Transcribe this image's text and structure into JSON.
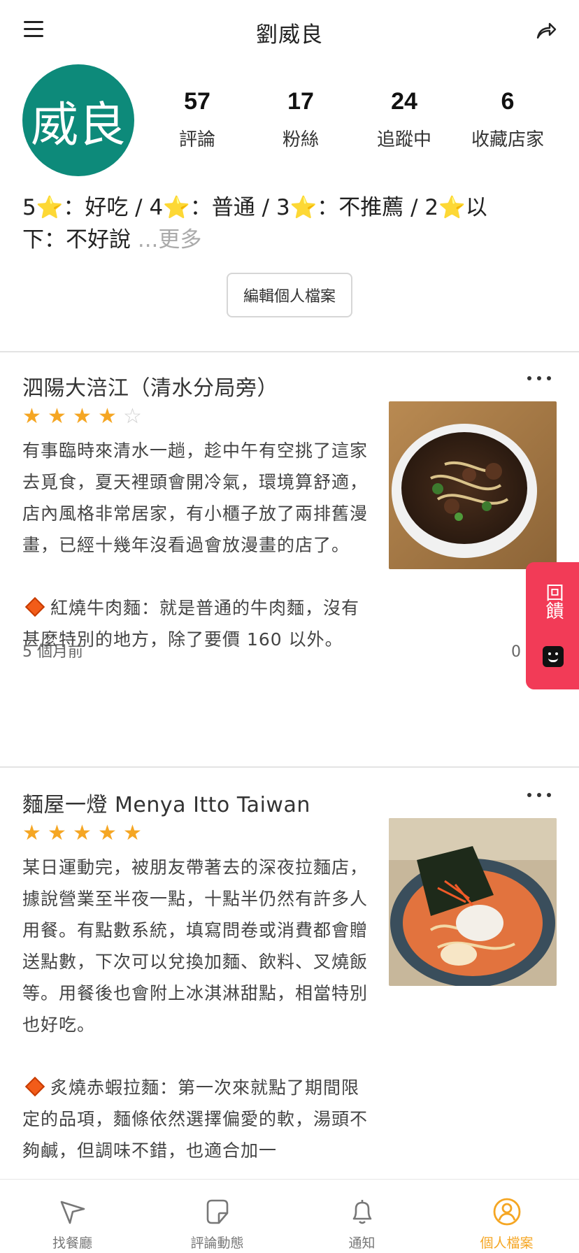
{
  "header": {
    "title": "劉威良"
  },
  "profile": {
    "avatar_text": "威良",
    "stats": [
      {
        "num": "57",
        "label": "評論"
      },
      {
        "num": "17",
        "label": "粉絲"
      },
      {
        "num": "24",
        "label": "追蹤中"
      },
      {
        "num": "6",
        "label": "收藏店家"
      }
    ],
    "bio_line1": "5⭐：好吃 / 4⭐：普通 / 3⭐：不推薦 / 2⭐以",
    "bio_line2": "下：不好說",
    "bio_more": " ...更多",
    "edit_label": "編輯個人檔案"
  },
  "reviews": [
    {
      "name": "泗陽大涪江（清水分局旁）",
      "rating": 4,
      "body": "有事臨時來清水一趟，趁中午有空挑了這家去覓食，夏天裡頭會開冷氣，環境算舒適，店內風格非常居家，有小櫃子放了兩排舊漫畫，已經十幾年沒看過會放漫畫的店了。",
      "dish": "紅燒牛肉麵：就是普通的牛肉麵，沒有甚麼特別的地方，除了要價 160 以外。",
      "time": "5 個月前",
      "likes": "0 個讚"
    },
    {
      "name": "麵屋一燈 Menya Itto Taiwan",
      "rating": 5,
      "body": "某日運動完，被朋友帶著去的深夜拉麵店，據說營業至半夜一點，十點半仍然有許多人用餐。有點數系統，填寫問卷或消費都會贈送點數，下次可以兌換加麵、飲料、叉燒飯等。用餐後也會附上冰淇淋甜點，相當特別也好吃。",
      "dish": "炙燒赤蝦拉麵：第一次來就點了期間限定的品項，麵條依然選擇偏愛的軟，湯頭不夠鹹，但調味不錯，也適合加一"
    }
  ],
  "feedback": {
    "label": "回饋"
  },
  "nav": [
    {
      "label": "找餐廳",
      "icon": "navigation-arrow-icon",
      "active": false
    },
    {
      "label": "評論動態",
      "icon": "note-icon",
      "active": false
    },
    {
      "label": "通知",
      "icon": "bell-icon",
      "active": false
    },
    {
      "label": "個人檔案",
      "icon": "profile-icon",
      "active": true
    }
  ],
  "colors": {
    "accent": "#f5a623",
    "avatar_bg": "#0d8a7a",
    "feedback_bg": "#f23b57",
    "diamond": "#f25c19"
  }
}
